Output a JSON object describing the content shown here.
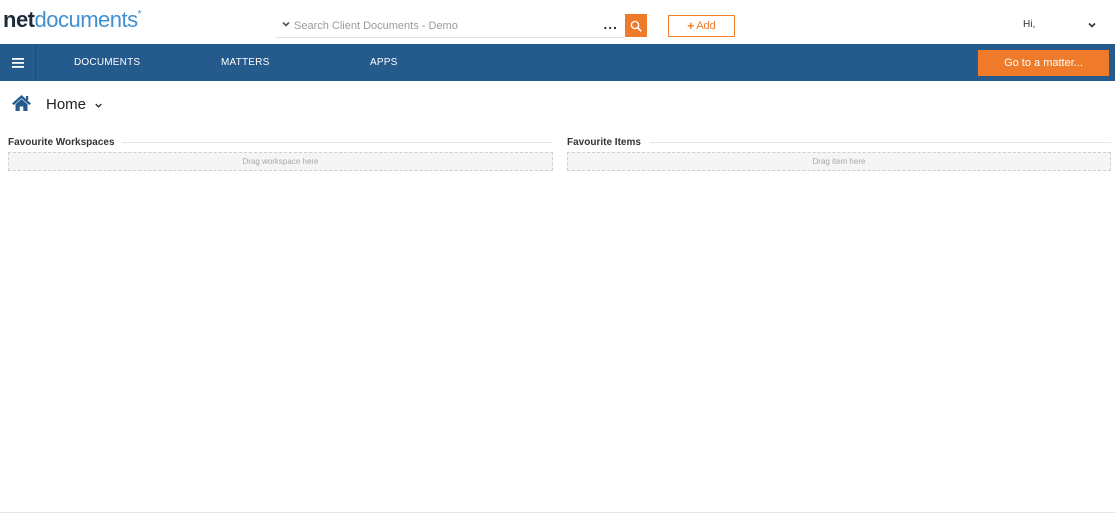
{
  "logo": {
    "part1": "net",
    "part2": "documents",
    "mark": "*"
  },
  "search": {
    "placeholder": "Search Client Documents - Demo",
    "value": "",
    "more_label": "..."
  },
  "add": {
    "plus": "+",
    "label": "Add"
  },
  "user": {
    "greeting": "Hi,"
  },
  "nav": {
    "items": [
      {
        "label": "DOCUMENTS"
      },
      {
        "label": "MATTERS"
      },
      {
        "label": "APPS"
      }
    ],
    "goto_label": "Go to a matter..."
  },
  "page": {
    "title": "Home"
  },
  "favourites": {
    "workspaces": {
      "title": "Favourite Workspaces",
      "hint": "Drag workspace here"
    },
    "items": {
      "title": "Favourite Items",
      "hint": "Drag item here"
    }
  },
  "colors": {
    "accent": "#ee7a2a",
    "nav": "#245a8c",
    "logo_blue": "#3f8fd2"
  },
  "icons": {
    "menu": "hamburger-menu-icon",
    "search": "search-icon",
    "home": "home-icon",
    "chevron": "chevron-down-icon"
  }
}
